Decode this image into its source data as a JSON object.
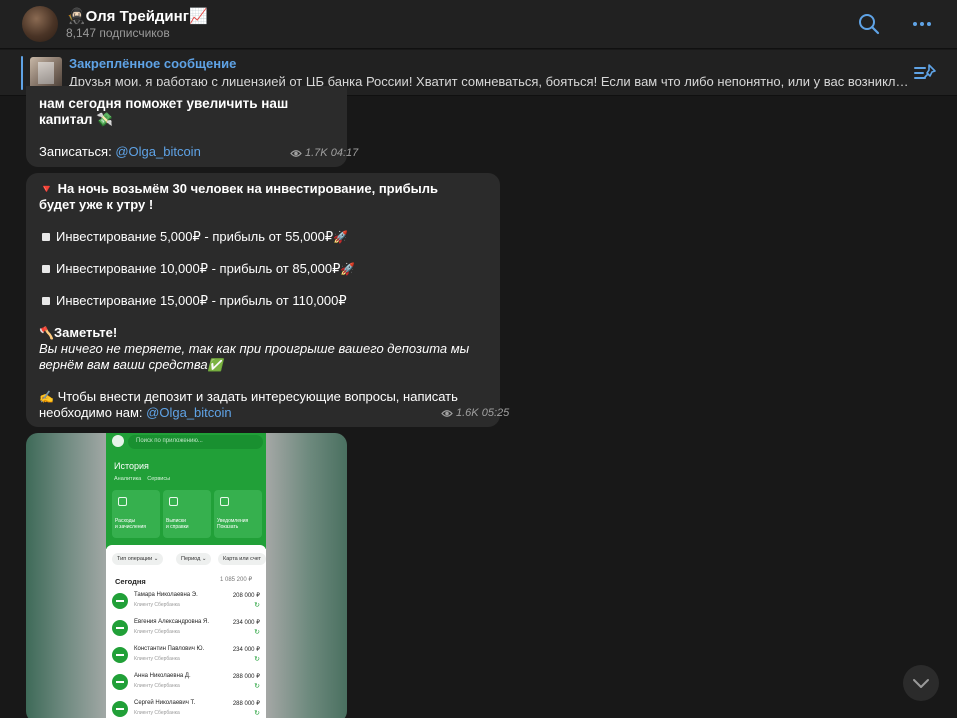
{
  "header": {
    "title": "🥷🏻Оля Трейдинг📈",
    "subscribers": "8,147 подписчиков"
  },
  "pinned": {
    "title": "Закреплённое сообщение",
    "text": "Друзья мои, я работаю с лицензией от ЦБ банка России!  Хватит сомневаться, бояться!  Если вам что либо непонятно, или у вас возникли вопросы — пишите мне"
  },
  "messages": [
    {
      "text_line1": "нам сегодня поможет увеличить наш",
      "text_line2": "капитал 💸",
      "signup_label": "Записаться: ",
      "signup_link": "@Olga_bitcoin",
      "views": "1.7K",
      "time": "04:17"
    },
    {
      "headline_emoji": "🔻",
      "headline_line1": "На ночь возьмём 30 человек на инвестирование, прибыль",
      "headline_line2": "будет уже к утру !",
      "offers": [
        {
          "text": "Инвестирование 5,000₽ -  прибыль от 55,000₽",
          "emoji": "🚀"
        },
        {
          "text": "Инвестирование 10,000₽ -  прибыль от 85,000₽",
          "emoji": "🚀"
        },
        {
          "text": "Инвестирование 15,000₽ - прибыль от 110,000₽",
          "emoji": ""
        }
      ],
      "note_emoji": "🪓",
      "note_title": "Заметьте!",
      "note_line1": "Вы ничего не теряете, так как при проигрыше вашего депозита мы",
      "note_line2": "вернём вам ваши средства",
      "note_check": "✅",
      "cta_emoji": "✍️",
      "cta_line1": "Чтобы внести депозит и задать интересующие вопросы, написать",
      "cta_line2": "необходимо нам: ",
      "cta_link": "@Olga_bitcoin",
      "views": "1.6K",
      "time": "05:25"
    }
  ],
  "screenshot": {
    "search_placeholder": "Поиск по приложению...",
    "title": "История",
    "tabs": [
      "Аналитика",
      "Сервисы"
    ],
    "tiles": [
      {
        "line1": "Расходы",
        "line2": "и зачисления"
      },
      {
        "line1": "Выписки",
        "line2": "и справки"
      },
      {
        "line1": "Уведомления",
        "line2": "Показать"
      }
    ],
    "chips": [
      "Тип операции ⌄",
      "Период ⌄",
      "Карта или счет"
    ],
    "today_label": "Сегодня",
    "today_total": "1 085 200 ₽",
    "rows": [
      {
        "name": "Тамара Николаевна Э.",
        "sub": "Клиенту Сбербанка",
        "amount": "208 000 ₽"
      },
      {
        "name": "Евгения Александровна Я.",
        "sub": "Клиенту Сбербанка",
        "amount": "234 000 ₽"
      },
      {
        "name": "Константин Павлович Ю.",
        "sub": "Клиенту Сбербанка",
        "amount": "234 000 ₽"
      },
      {
        "name": "Анна Николаевна Д.",
        "sub": "Клиенту Сбербанка",
        "amount": "288 000 ₽"
      },
      {
        "name": "Сергей Николаевич Т.",
        "sub": "Клиенту Сбербанка",
        "amount": "288 000 ₽"
      }
    ]
  },
  "colors": {
    "accent": "#5fa3e6",
    "bubble": "#2b2b2b",
    "background": "#181818",
    "sber_green": "#21a038"
  }
}
